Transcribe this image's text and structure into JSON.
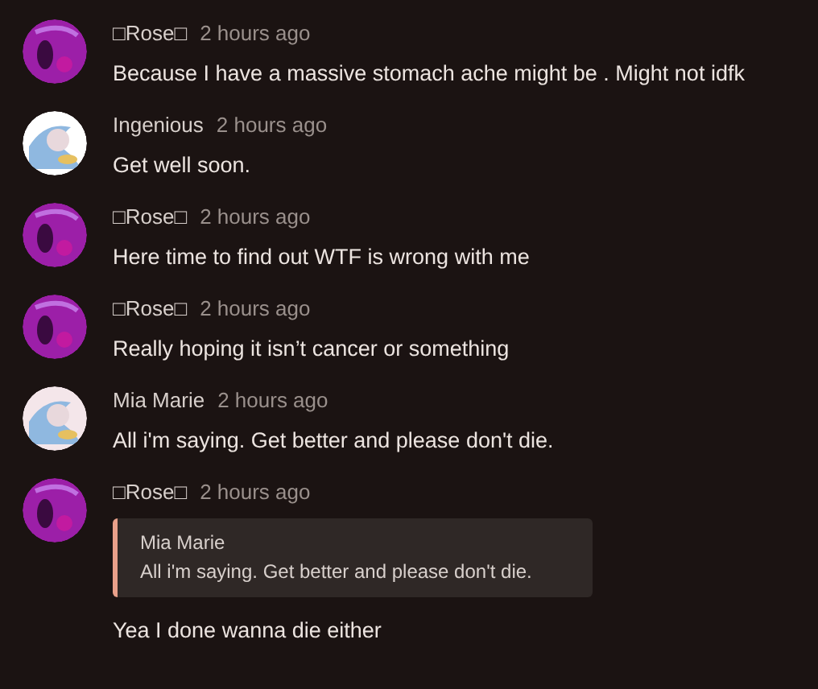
{
  "comments": [
    {
      "author": "□Rose□",
      "time": "2 hours ago",
      "text": "Because I have a massive stomach ache might be . Might not idfk"
    },
    {
      "author": "Ingenious",
      "time": "2 hours ago",
      "text": "Get well soon."
    },
    {
      "author": "□Rose□",
      "time": "2 hours ago",
      "text": "Here time to find out WTF is wrong with me"
    },
    {
      "author": "□Rose□",
      "time": "2 hours ago",
      "text": "Really hoping it isn’t cancer or something"
    },
    {
      "author": "Mia Marie",
      "time": "2 hours ago",
      "text": "All i'm saying. Get better and please don't die."
    },
    {
      "author": "□Rose□",
      "time": "2 hours ago",
      "quote": {
        "author": "Mia Marie",
        "text": "All i'm saying. Get better and please don't die."
      },
      "text": "Yea I done wanna die either"
    }
  ]
}
